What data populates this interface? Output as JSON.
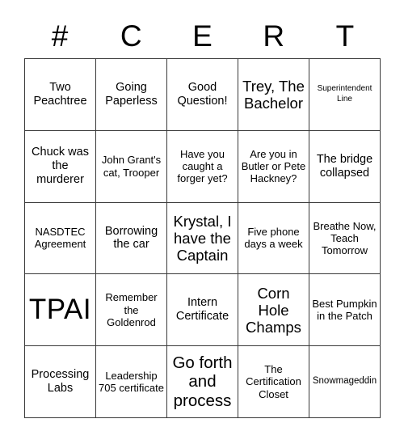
{
  "card": {
    "header_letters": [
      "#",
      "C",
      "E",
      "R",
      "T"
    ],
    "rows": [
      [
        {
          "text": "Two Peachtree",
          "size": "fs-m"
        },
        {
          "text": "Going Paperless",
          "size": "fs-m"
        },
        {
          "text": "Good Question!",
          "size": "fs-m"
        },
        {
          "text": "Trey, The Bachelor",
          "size": "fs-l"
        },
        {
          "text": "Superintendent Line",
          "size": "fs-xs"
        }
      ],
      [
        {
          "text": "Chuck was the murderer",
          "size": "fs-m"
        },
        {
          "text": "John Grant's cat, Trooper",
          "size": "fs-sm"
        },
        {
          "text": "Have you caught a forger yet?",
          "size": "fs-sm"
        },
        {
          "text": "Are you in Butler or Pete Hackney?",
          "size": "fs-sm"
        },
        {
          "text": "The bridge collapsed",
          "size": "fs-m"
        }
      ],
      [
        {
          "text": "NASDTEC Agreement",
          "size": "fs-sm"
        },
        {
          "text": "Borrowing the car",
          "size": "fs-m"
        },
        {
          "text": "Krystal, I have the Captain",
          "size": "fs-l"
        },
        {
          "text": "Five phone days a week",
          "size": "fs-sm"
        },
        {
          "text": "Breathe Now, Teach Tomorrow",
          "size": "fs-sm"
        }
      ],
      [
        {
          "text": "TPAI",
          "size": "fs-xxl"
        },
        {
          "text": "Remember the Goldenrod",
          "size": "fs-sm"
        },
        {
          "text": "Intern Certificate",
          "size": "fs-m"
        },
        {
          "text": "Corn Hole Champs",
          "size": "fs-l"
        },
        {
          "text": "Best Pumpkin in the Patch",
          "size": "fs-sm"
        }
      ],
      [
        {
          "text": "Processing Labs",
          "size": "fs-m"
        },
        {
          "text": "Leadership 705 certificate",
          "size": "fs-sm"
        },
        {
          "text": "Go forth and process",
          "size": "fs-xl"
        },
        {
          "text": "The Certification Closet",
          "size": "fs-sm"
        },
        {
          "text": "Snowmageddin",
          "size": "fs-s"
        }
      ]
    ]
  },
  "colors": {
    "background": "#ffffff",
    "grid_line": "#3a3a3a",
    "text": "#000000"
  }
}
